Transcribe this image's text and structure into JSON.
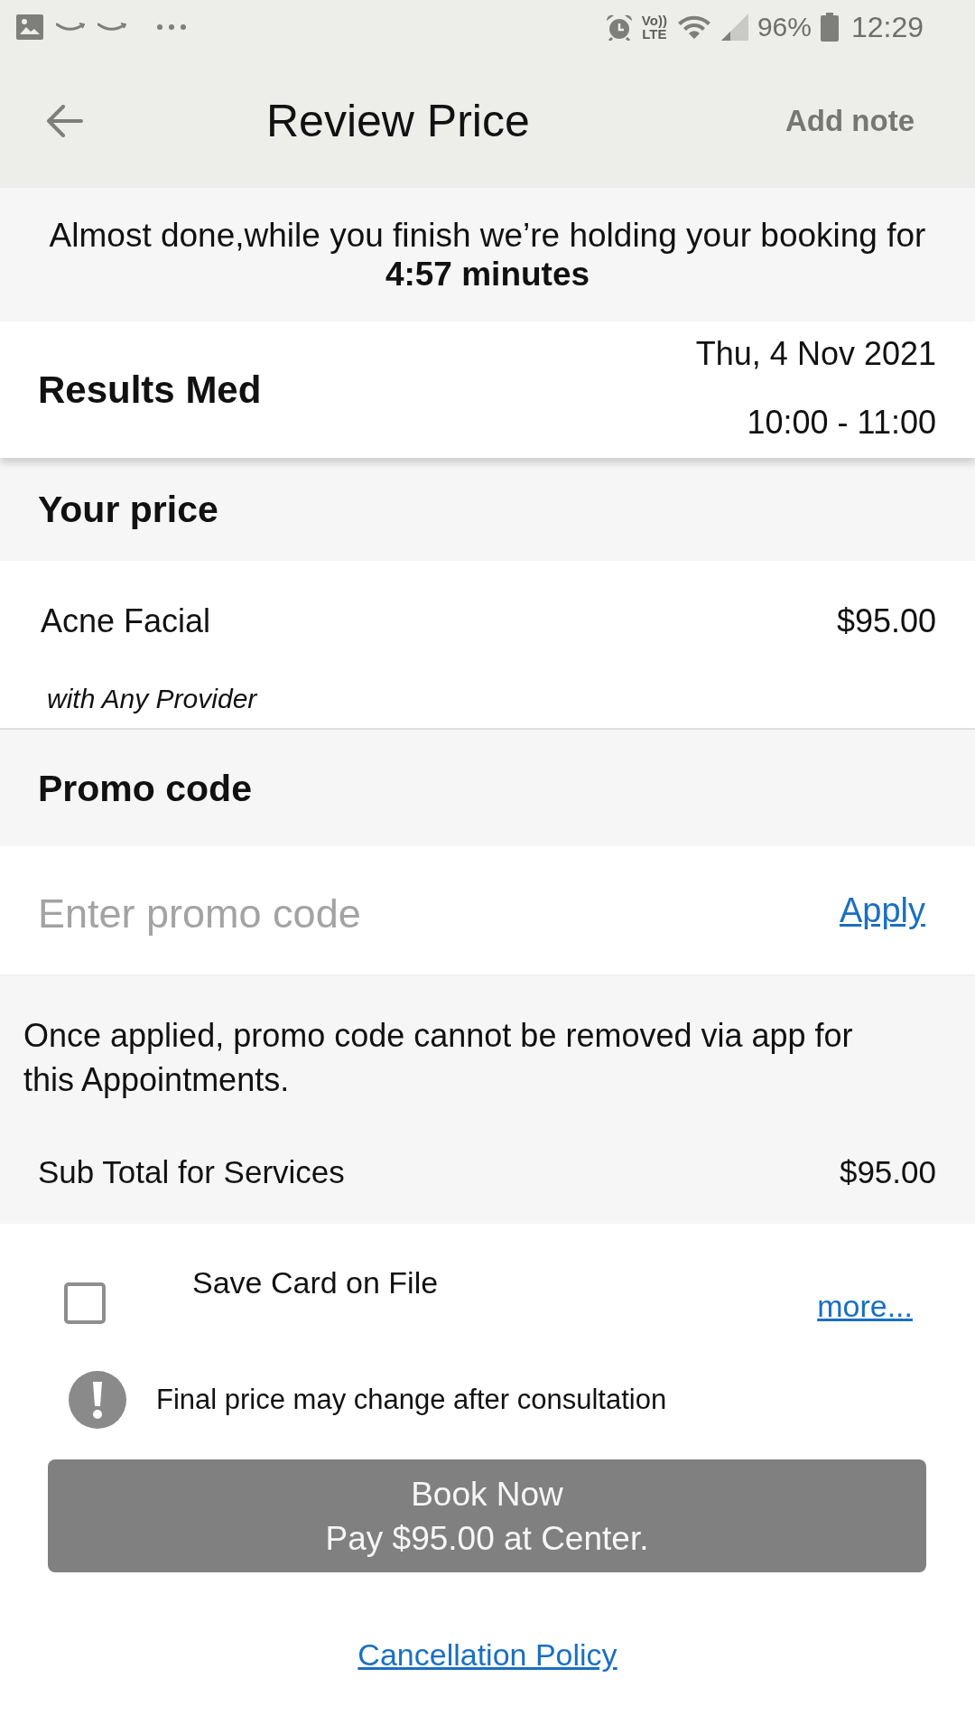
{
  "status_bar": {
    "network_badge": [
      "Vo))",
      "LTE"
    ],
    "battery_percent": "96%",
    "time": "12:29"
  },
  "header": {
    "title": "Review Price",
    "action": "Add note"
  },
  "hold_banner": {
    "message": "Almost done,while you finish we’re holding your booking for",
    "countdown": "4:57 minutes"
  },
  "appointment": {
    "center": "Results Med",
    "date": "Thu, 4 Nov 2021",
    "time": "10:00 - 11:00"
  },
  "price_section": {
    "title": "Your price",
    "services": [
      {
        "name": "Acne Facial",
        "price": "$95.00",
        "provider": "with Any Provider"
      }
    ]
  },
  "promo_section": {
    "title": "Promo code",
    "placeholder": "Enter promo code",
    "apply_label": "Apply",
    "note": "Once applied, promo code cannot be removed via app for this Appointments."
  },
  "subtotal": {
    "label": "Sub Total for Services",
    "amount": "$95.00"
  },
  "save_card": {
    "label": "Save Card on File",
    "checked": false,
    "more_label": "more..."
  },
  "notice": "Final price may change after consultation",
  "book_button": {
    "lines": [
      "Book Now",
      "Pay $95.00 at Center."
    ]
  },
  "cancellation_link": "Cancellation Policy"
}
